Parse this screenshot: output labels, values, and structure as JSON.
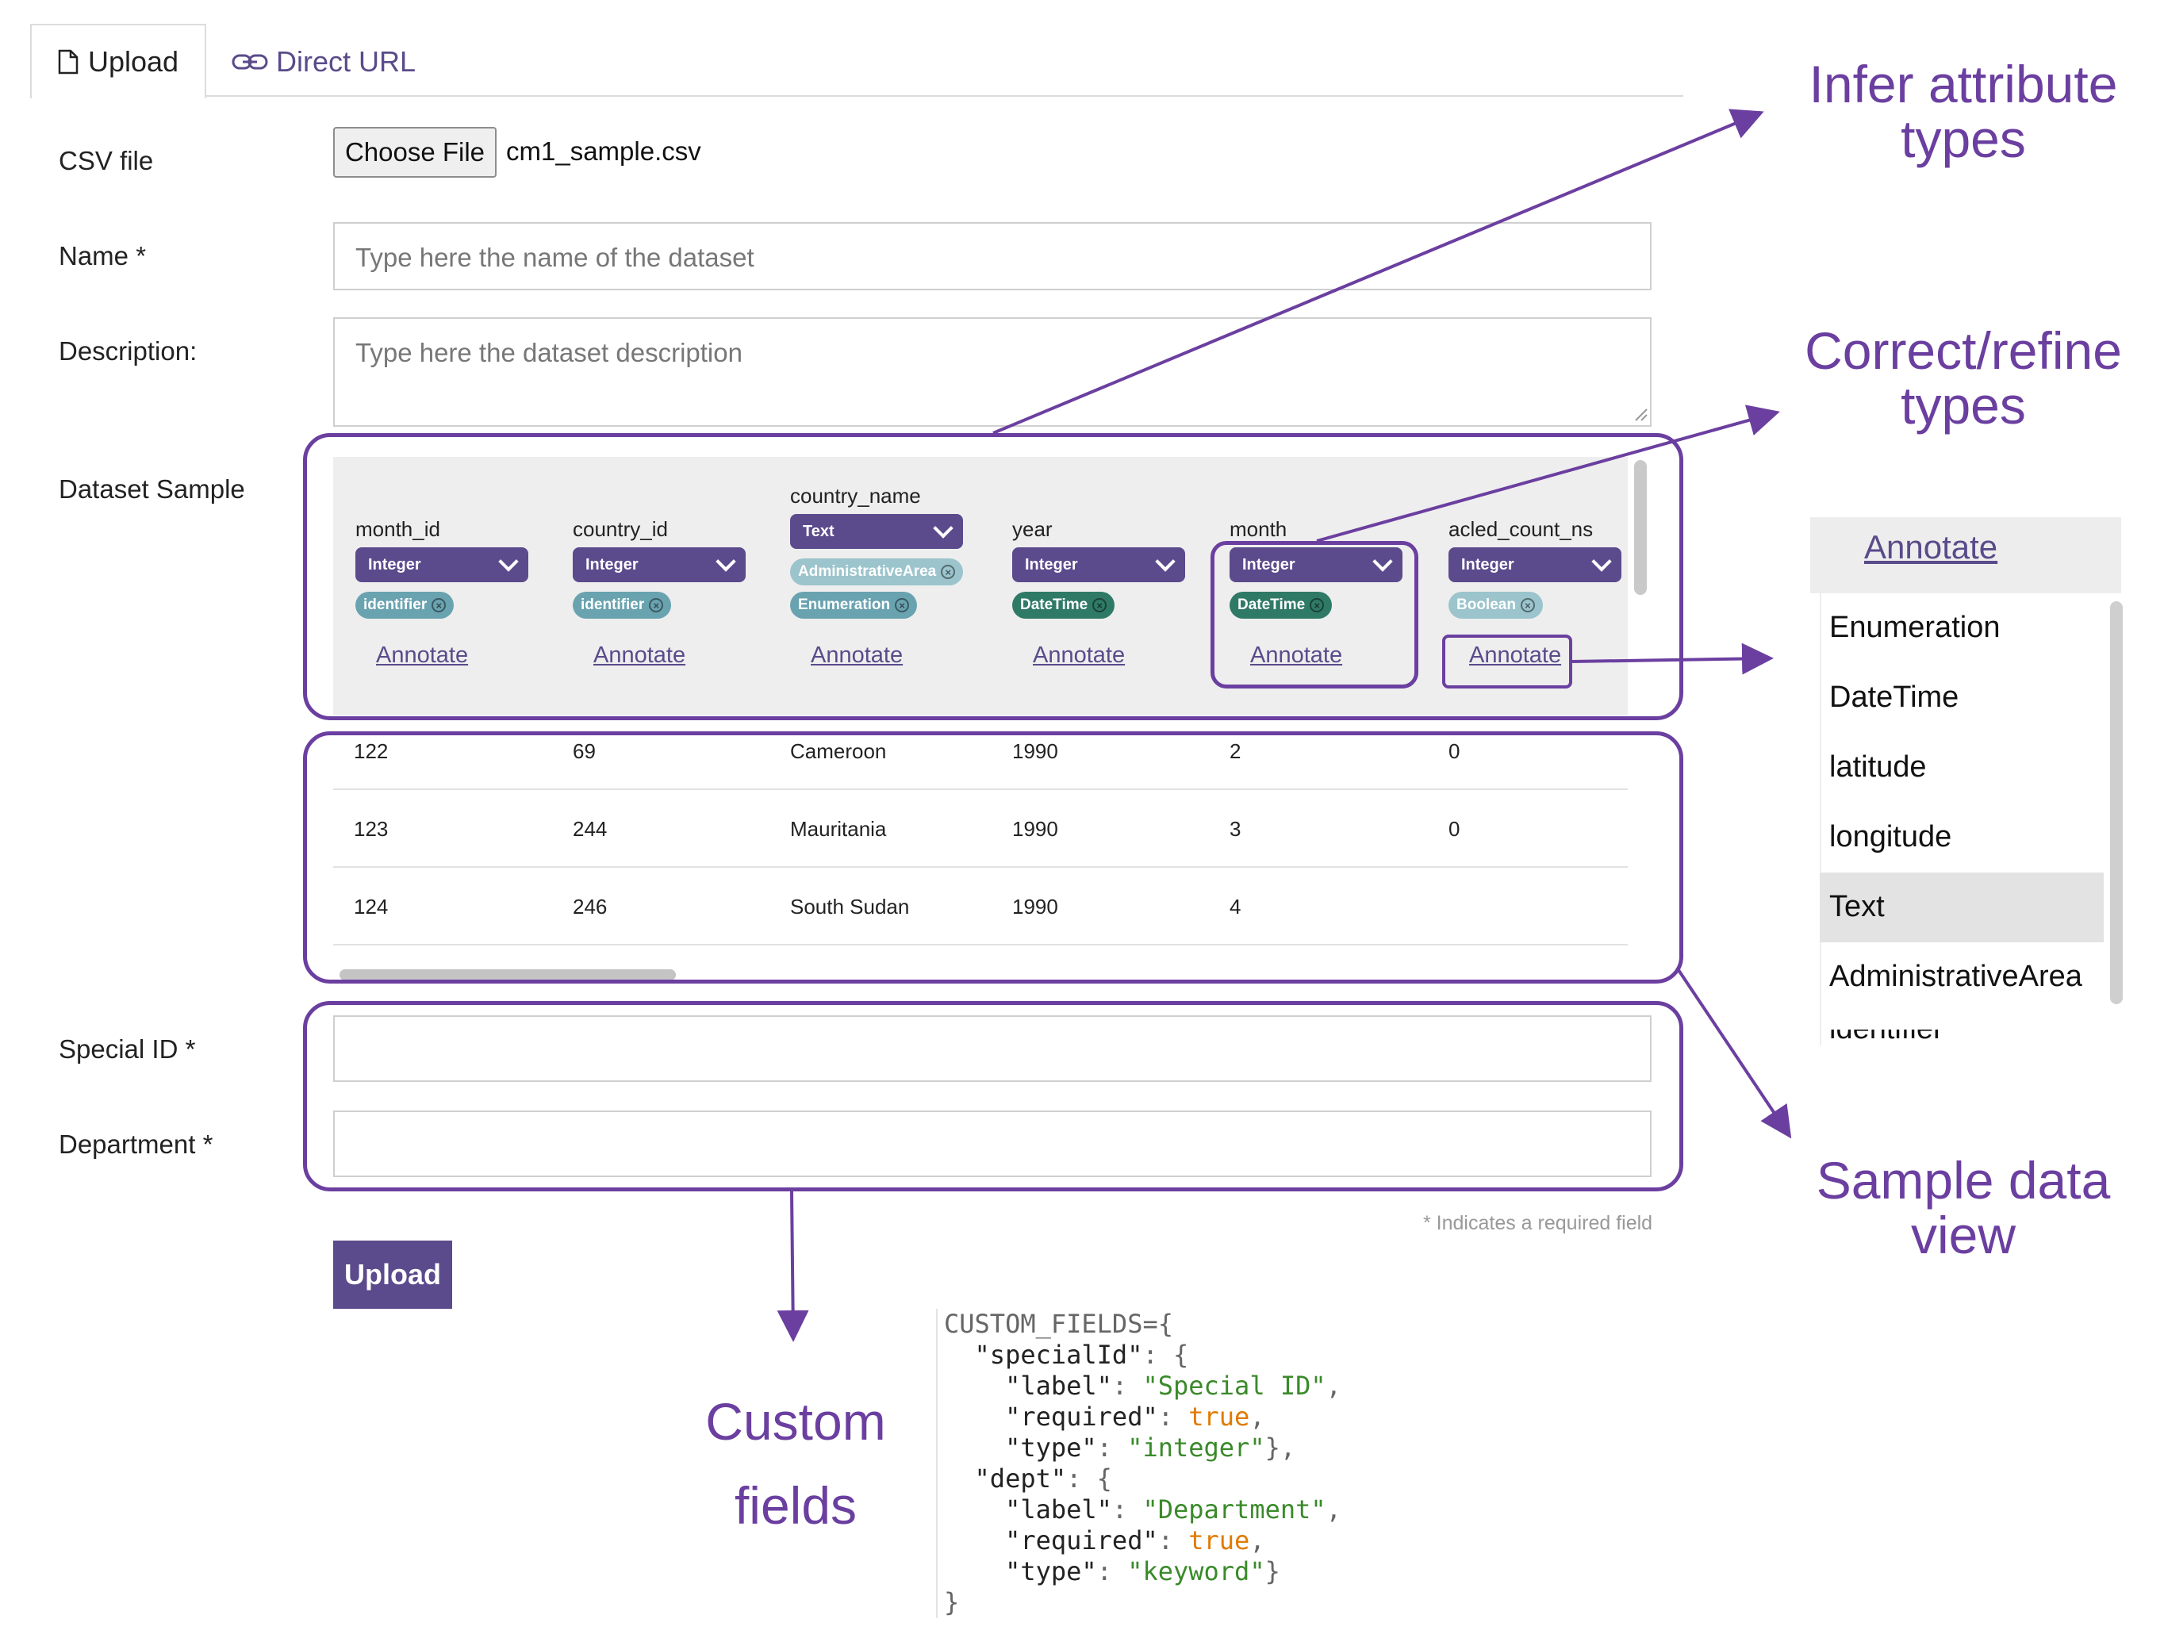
{
  "tabs": [
    {
      "label": "Upload",
      "icon": "file-icon"
    },
    {
      "label": "Direct URL",
      "icon": "link-icon"
    }
  ],
  "form": {
    "csv_label": "CSV file",
    "choose_file_label": "Choose File",
    "file_name": "cm1_sample.csv",
    "name_label": "Name *",
    "name_placeholder": "Type here the name of the dataset",
    "description_label": "Description:",
    "description_placeholder": "Type here the dataset description",
    "sample_label": "Dataset Sample",
    "special_id_label": "Special ID *",
    "department_label": "Department *",
    "required_note": "* Indicates a required field",
    "upload_label": "Upload"
  },
  "sample": {
    "columns": [
      {
        "name": "month_id",
        "type": "Integer",
        "tags": [
          {
            "label": "identifier",
            "color": "#6aa3b0"
          }
        ],
        "annotate": "Annotate"
      },
      {
        "name": "country_id",
        "type": "Integer",
        "tags": [
          {
            "label": "identifier",
            "color": "#6aa3b0"
          }
        ],
        "annotate": "Annotate"
      },
      {
        "name": "country_name",
        "type": "Text",
        "tags": [
          {
            "label": "AdministrativeArea",
            "color": "#9bc4cc"
          },
          {
            "label": "Enumeration",
            "color": "#6aa3b0"
          }
        ],
        "annotate": "Annotate"
      },
      {
        "name": "year",
        "type": "Integer",
        "tags": [
          {
            "label": "DateTime",
            "color": "#2f7a66"
          }
        ],
        "annotate": "Annotate"
      },
      {
        "name": "month",
        "type": "Integer",
        "tags": [
          {
            "label": "DateTime",
            "color": "#2f7a66"
          }
        ],
        "annotate": "Annotate"
      },
      {
        "name": "acled_count_ns",
        "type": "Integer",
        "tags": [
          {
            "label": "Boolean",
            "color": "#9bc4cc"
          }
        ],
        "annotate": "Annotate"
      }
    ],
    "rows": [
      [
        "122",
        "69",
        "Cameroon",
        "1990",
        "2",
        "0"
      ],
      [
        "123",
        "244",
        "Mauritania",
        "1990",
        "3",
        "0"
      ],
      [
        "124",
        "246",
        "South Sudan",
        "1990",
        "4",
        ""
      ]
    ]
  },
  "annotations": {
    "infer": [
      "Infer attribute",
      "types"
    ],
    "correct": [
      "Correct/refine",
      "types"
    ],
    "sample_view": [
      "Sample data",
      "view"
    ],
    "custom": [
      "Custom",
      "fields"
    ]
  },
  "dropdown": {
    "header": "Annotate",
    "items": [
      "Enumeration",
      "DateTime",
      "latitude",
      "longitude",
      "Text",
      "AdministrativeArea",
      "identifier"
    ],
    "highlighted": "Text"
  },
  "code": {
    "l1": "CUSTOM_FIELDS={",
    "l2_key": "\"specialId\"",
    "l3_key": "\"label\"",
    "l3_val": "\"Special ID\"",
    "l4_key": "\"required\"",
    "l4_val": "true",
    "l5_key": "\"type\"",
    "l5_val": "\"integer\"",
    "l6_key": "\"dept\"",
    "l7_key": "\"label\"",
    "l7_val": "\"Department\"",
    "l8_key": "\"required\"",
    "l8_val": "true",
    "l9_key": "\"type\"",
    "l9_val": "\"keyword\"",
    "l10": "}"
  },
  "colors": {
    "accent": "#5b4a8c",
    "highlight": "#6b3fa0"
  }
}
